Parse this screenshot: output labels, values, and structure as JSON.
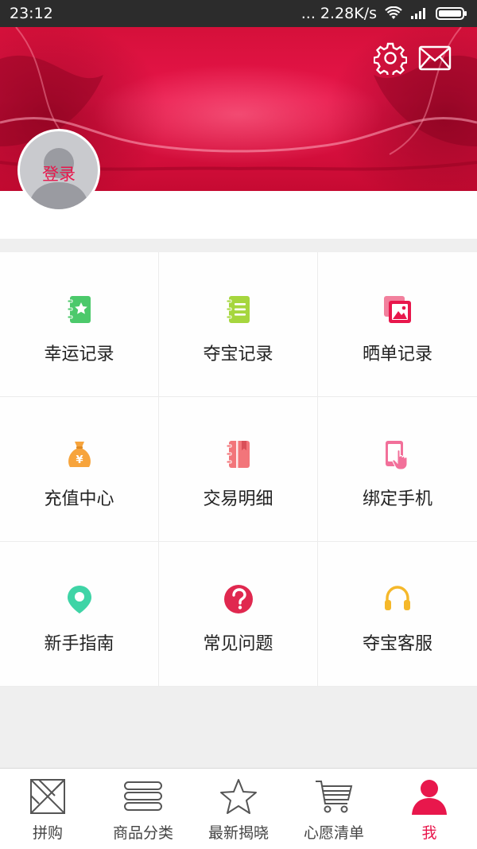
{
  "status_bar": {
    "time": "23:12",
    "network_speed": "... 2.28K/s"
  },
  "header": {
    "settings_icon": "gear-icon",
    "message_icon": "mail-icon",
    "avatar_login_label": "登录",
    "accent_color": "#e8174c"
  },
  "menu": {
    "items": [
      {
        "label": "幸运记录",
        "icon": "notebook-star-icon",
        "color": "#4cc96b"
      },
      {
        "label": "夺宝记录",
        "icon": "notebook-lines-icon",
        "color": "#a6d63e"
      },
      {
        "label": "晒单记录",
        "icon": "photo-stack-icon",
        "color": "#e8174c"
      },
      {
        "label": "充值中心",
        "icon": "money-bag-icon",
        "color": "#f7a43c"
      },
      {
        "label": "交易明细",
        "icon": "ledger-icon",
        "color": "#f2757a"
      },
      {
        "label": "绑定手机",
        "icon": "phone-tap-icon",
        "color": "#f2709a"
      },
      {
        "label": "新手指南",
        "icon": "location-pin-icon",
        "color": "#3fd4a6"
      },
      {
        "label": "常见问题",
        "icon": "question-icon",
        "color": "#e0284f"
      },
      {
        "label": "夺宝客服",
        "icon": "headset-icon",
        "color": "#f5b82a"
      }
    ]
  },
  "tabbar": {
    "active_color": "#e8174c",
    "tabs": [
      {
        "label": "拼购",
        "icon": "tangram-icon",
        "active": false
      },
      {
        "label": "商品分类",
        "icon": "stack-lines-icon",
        "active": false
      },
      {
        "label": "最新揭晓",
        "icon": "star-icon",
        "active": false
      },
      {
        "label": "心愿清单",
        "icon": "cart-icon",
        "active": false
      },
      {
        "label": "我",
        "icon": "person-icon",
        "active": true
      }
    ]
  }
}
